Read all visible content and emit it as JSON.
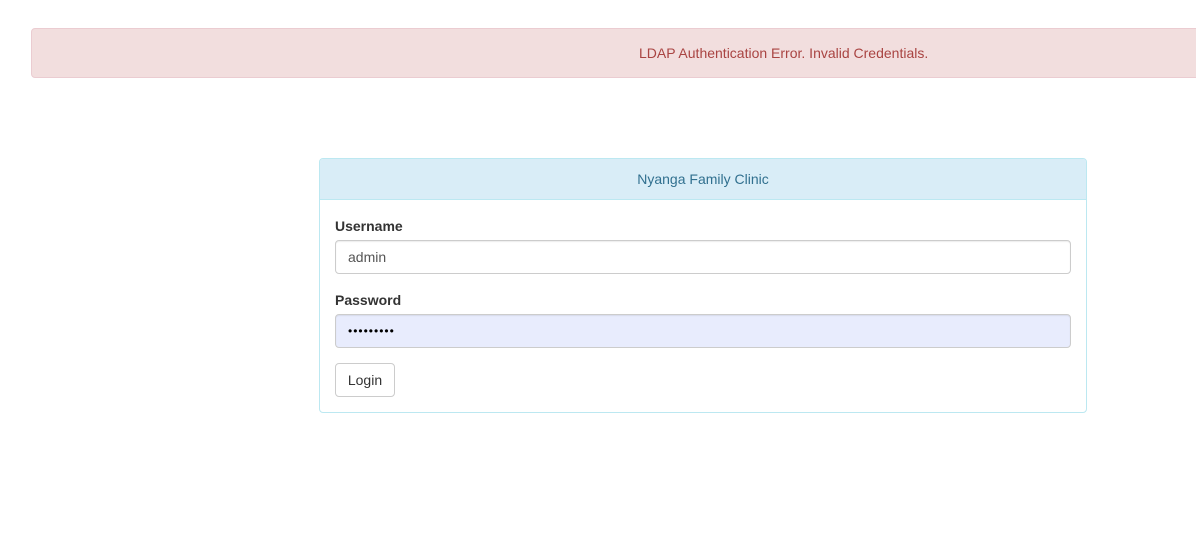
{
  "alert": {
    "message": "LDAP Authentication Error. Invalid Credentials.",
    "color": "#a94442",
    "background": "#f2dede"
  },
  "login_panel": {
    "heading": "Nyanga Family Clinic",
    "username_label": "Username",
    "username_value": "admin",
    "password_label": "Password",
    "password_value": "•••••••••",
    "login_button": "Login",
    "accent_color": "#31708f"
  }
}
